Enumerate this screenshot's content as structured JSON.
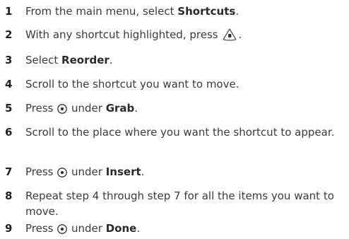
{
  "steps": [
    {
      "num": "1",
      "pre": "From the main menu, select ",
      "bold": "Shortcuts",
      "post": "."
    },
    {
      "num": "2",
      "pre": "With any shortcut highlighted, press ",
      "icon": "menu-key-icon",
      "post": "."
    },
    {
      "num": "3",
      "pre": "Select ",
      "bold": "Reorder",
      "post": "."
    },
    {
      "num": "4",
      "text": "Scroll to the shortcut you want to move."
    },
    {
      "num": "5",
      "pre": "Press ",
      "icon": "select-button-icon",
      "mid": " under ",
      "bold": "Grab",
      "post": "."
    },
    {
      "num": "6",
      "text": "Scroll to the place where you want the shortcut to appear."
    },
    {
      "num": "7",
      "pre": "Press ",
      "icon": "select-button-icon",
      "mid": " under ",
      "bold": "Insert",
      "post": "."
    },
    {
      "num": "8",
      "text": "Repeat step 4 through step 7 for all the items you want to move."
    },
    {
      "num": "9",
      "pre": "Press ",
      "icon": "select-button-icon",
      "mid": " under ",
      "bold": "Done",
      "post": "."
    }
  ]
}
